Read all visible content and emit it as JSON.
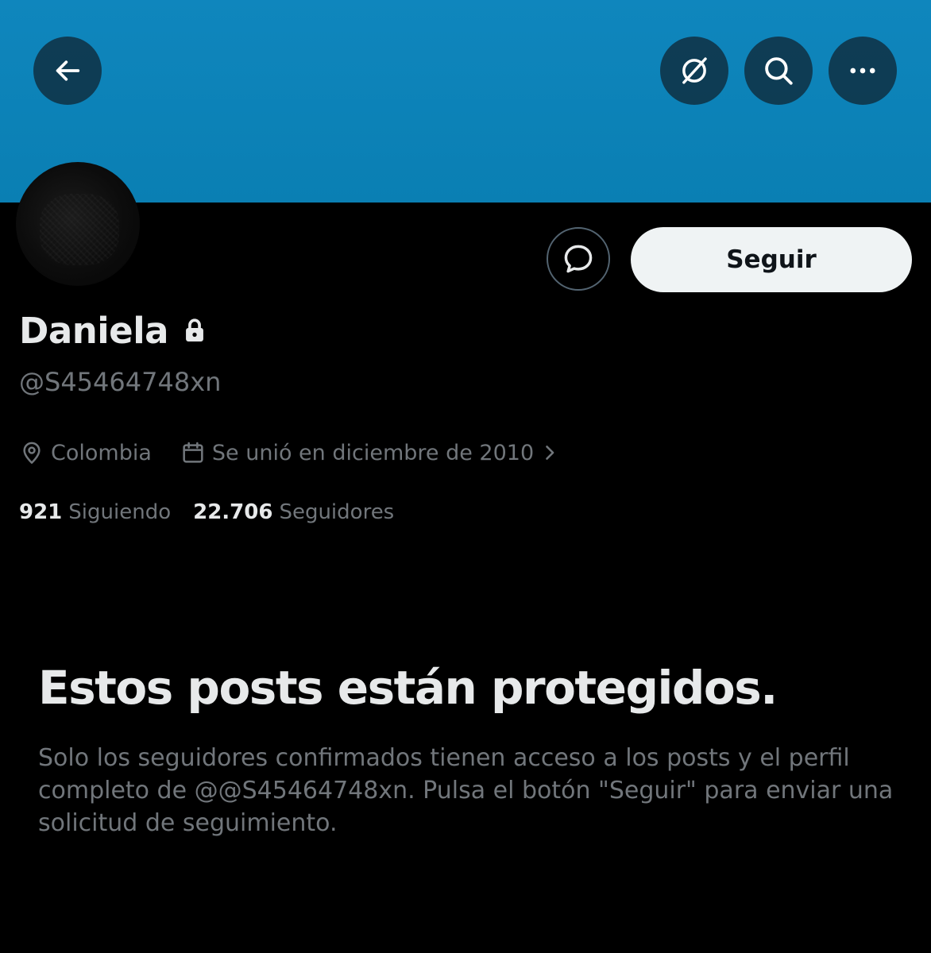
{
  "colors": {
    "banner": "#0f86bd",
    "background": "#000000",
    "primary_text": "#e7e9ea",
    "secondary_text": "#71767b",
    "follow_button_bg": "#eff3f4",
    "follow_button_text": "#0f1419"
  },
  "header": {
    "back_icon": "arrow-left-icon",
    "grok_icon": "grok-icon",
    "search_icon": "search-icon",
    "more_icon": "more-dots-icon"
  },
  "profile": {
    "display_name": "Daniela",
    "protected_icon": "lock-icon",
    "handle": "@S45464748xn",
    "location": "Colombia",
    "location_icon": "location-pin-icon",
    "joined": "Se unió en diciembre de 2010",
    "joined_icon": "calendar-icon",
    "following_count": "921",
    "following_label": "Siguiendo",
    "followers_count": "22.706",
    "followers_label": "Seguidores"
  },
  "actions": {
    "message_icon": "message-bubble-icon",
    "follow_label": "Seguir"
  },
  "protected_notice": {
    "title": "Estos posts están protegidos.",
    "description": "Solo los seguidores confirmados tienen acceso a los posts y el perfil completo de @@S45464748xn. Pulsa el botón \"Seguir\" para enviar una solicitud de seguimiento."
  }
}
